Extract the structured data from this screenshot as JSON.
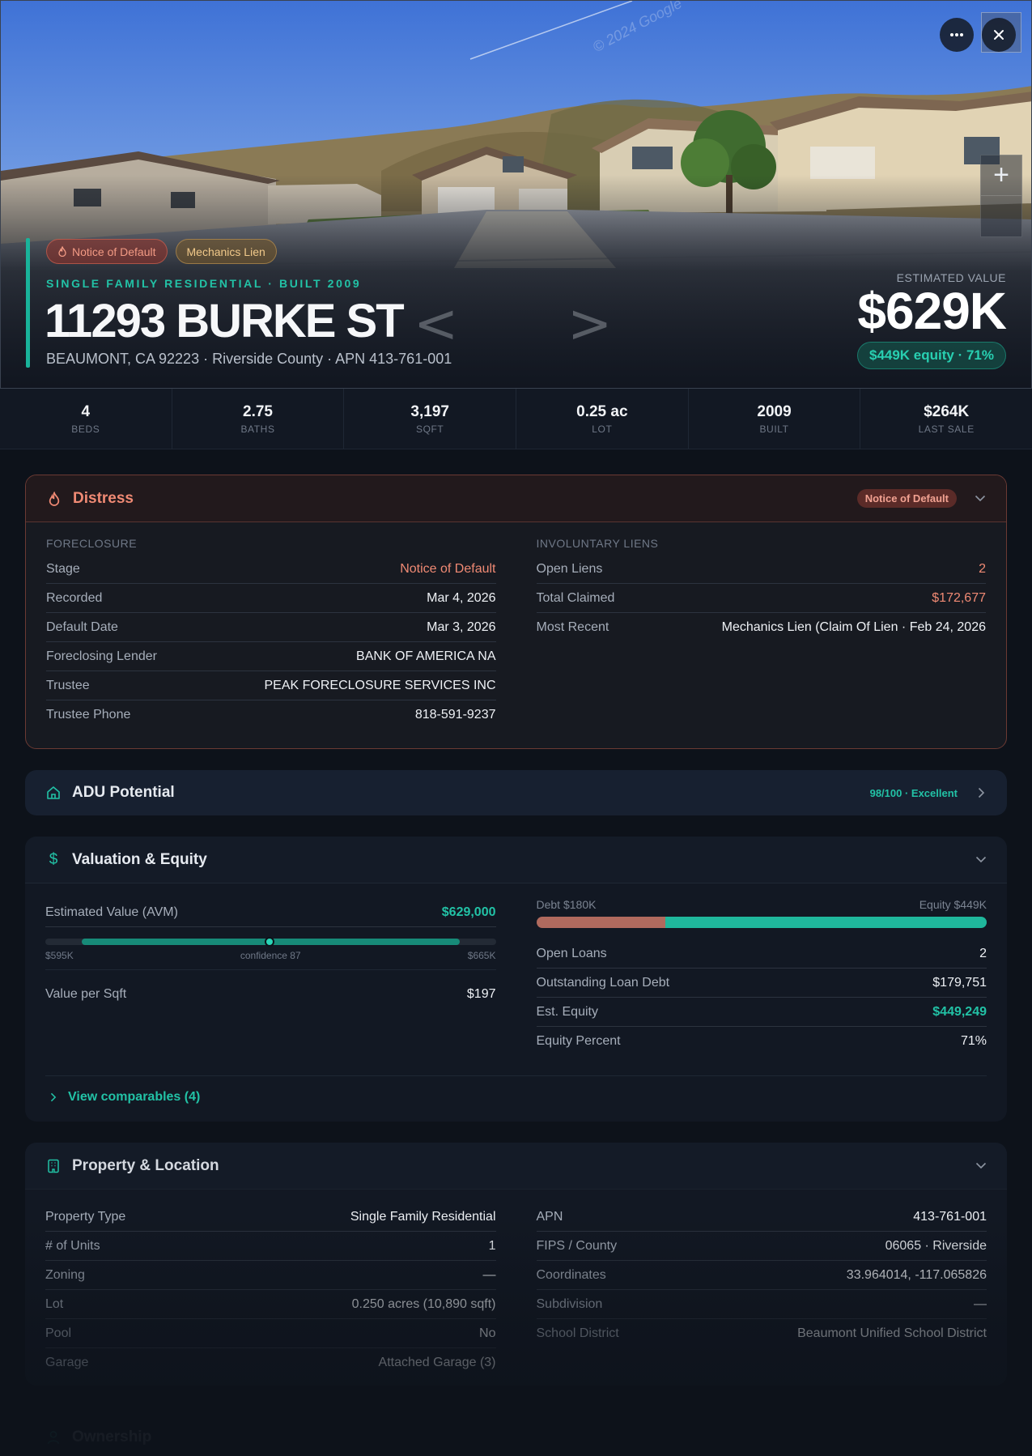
{
  "hero": {
    "watermark": "© 2024 Google",
    "badges": [
      {
        "label": "Notice of Default",
        "icon": "flame-icon"
      },
      {
        "label": "Mechanics Lien"
      }
    ],
    "property_type": "SINGLE FAMILY RESIDENTIAL · BUILT 2009",
    "address": "11293 BURKE ST",
    "subaddress": "BEAUMONT, CA 92223 · Riverside County · APN 413-761-001",
    "estimated_label": "ESTIMATED VALUE",
    "estimated_value": "$629K",
    "equity_pill": "$449K equity · 71%",
    "more_icon": "more-horizontal-icon",
    "close_icon": "close-icon",
    "zoom_in_icon": "plus-icon"
  },
  "stats": [
    {
      "value": "4",
      "label": "BEDS"
    },
    {
      "value": "2.75",
      "label": "BATHS"
    },
    {
      "value": "3,197",
      "label": "SQFT"
    },
    {
      "value": "0.25 ac",
      "label": "LOT"
    },
    {
      "value": "2009",
      "label": "BUILT"
    },
    {
      "value": "$264K",
      "label": "LAST SALE"
    }
  ],
  "distress": {
    "title": "Distress",
    "chip": "Notice of Default",
    "foreclosure": {
      "label": "FORECLOSURE",
      "rows": [
        {
          "k": "Stage",
          "v": "Notice of Default"
        },
        {
          "k": "Recorded",
          "v": "Mar 4, 2026"
        },
        {
          "k": "Default Date",
          "v": "Mar 3, 2026"
        },
        {
          "k": "Foreclosing Lender",
          "v": "BANK OF AMERICA NA"
        },
        {
          "k": "Trustee",
          "v": "PEAK FORECLOSURE SERVICES INC"
        },
        {
          "k": "Trustee Phone",
          "v": "818-591-9237"
        }
      ]
    },
    "liens": {
      "label": "INVOLUNTARY LIENS",
      "rows": [
        {
          "k": "Open Liens",
          "v": "2"
        },
        {
          "k": "Total Claimed",
          "v": "$172,677"
        },
        {
          "k": "Most Recent",
          "v": "Mechanics Lien (Claim Of Lien · Feb 24, 2026"
        }
      ]
    }
  },
  "adu": {
    "title": "ADU Potential",
    "score": "98/100 · Excellent"
  },
  "valuation": {
    "title": "Valuation & Equity",
    "avm_label": "Estimated Value (AVM)",
    "avm_value": "$629,000",
    "range_low": "$595K",
    "range_high": "$665K",
    "confidence": "confidence 87",
    "value_per_sqft_label": "Value per Sqft",
    "value_per_sqft": "$197",
    "debt_label": "Debt $180K",
    "equity_label": "Equity $449K",
    "debt_fraction": 0.286,
    "rows": [
      {
        "k": "Open Loans",
        "v": "2"
      },
      {
        "k": "Outstanding Loan Debt",
        "v": "$179,751"
      },
      {
        "k": "Est. Equity",
        "v": "$449,249"
      },
      {
        "k": "Equity Percent",
        "v": "71%"
      }
    ],
    "comparables": "View comparables (4)"
  },
  "property": {
    "title": "Property & Location",
    "left": [
      {
        "k": "Property Type",
        "v": "Single Family Residential"
      },
      {
        "k": "# of Units",
        "v": "1"
      },
      {
        "k": "Zoning",
        "v": "—"
      },
      {
        "k": "Lot",
        "v": "0.250 acres (10,890 sqft)"
      },
      {
        "k": "Pool",
        "v": "No"
      },
      {
        "k": "Garage",
        "v": "Attached Garage (3)"
      }
    ],
    "right": [
      {
        "k": "APN",
        "v": "413-761-001"
      },
      {
        "k": "FIPS / County",
        "v": "06065 · Riverside"
      },
      {
        "k": "Coordinates",
        "v": "33.964014, -117.065826"
      },
      {
        "k": "Subdivision",
        "v": "—"
      },
      {
        "k": "School District",
        "v": "Beaumont Unified School District"
      }
    ]
  },
  "ownership": {
    "title": "Ownership"
  },
  "colors": {
    "accent": "#22c2a6",
    "distress": "#f08a74",
    "background": "#0d121a"
  }
}
